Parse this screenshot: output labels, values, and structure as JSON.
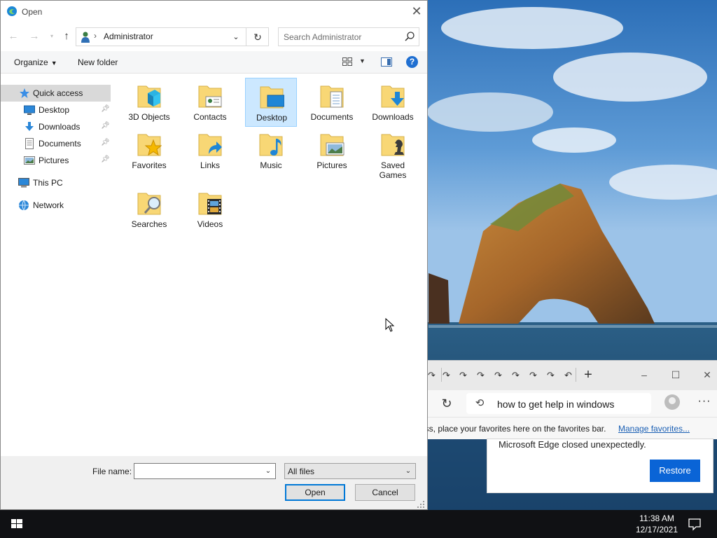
{
  "dialog": {
    "title": "Open",
    "nav": {
      "back_icon": "arrow-left-icon",
      "forward_icon": "arrow-right-icon",
      "recent_icon": "chevron-down-icon",
      "up_icon": "arrow-up-icon"
    },
    "path": {
      "crumb": "Administrator",
      "icon": "user-folder-icon"
    },
    "search": {
      "placeholder": "Search Administrator"
    },
    "command_bar": {
      "organize_label": "Organize",
      "new_folder_label": "New folder",
      "help_label": "?"
    },
    "nav_pane": {
      "items": [
        {
          "label": "Quick access",
          "icon": "star-icon",
          "selected": true
        },
        {
          "label": "Desktop",
          "icon": "desktop-icon",
          "pinned": true
        },
        {
          "label": "Downloads",
          "icon": "download-icon",
          "pinned": true
        },
        {
          "label": "Documents",
          "icon": "document-icon",
          "pinned": true
        },
        {
          "label": "Pictures",
          "icon": "pictures-icon",
          "pinned": true
        },
        {
          "label": "This PC",
          "icon": "computer-icon"
        },
        {
          "label": "Network",
          "icon": "network-icon"
        }
      ]
    },
    "folders": [
      {
        "label": "3D Objects",
        "icon": "cube-icon"
      },
      {
        "label": "Contacts",
        "icon": "contact-card-icon"
      },
      {
        "label": "Desktop",
        "icon": "desktop-icon",
        "selected": true
      },
      {
        "label": "Documents",
        "icon": "document-icon"
      },
      {
        "label": "Downloads",
        "icon": "download-icon"
      },
      {
        "label": "Favorites",
        "icon": "star-icon"
      },
      {
        "label": "Links",
        "icon": "link-arrow-icon"
      },
      {
        "label": "Music",
        "icon": "music-note-icon"
      },
      {
        "label": "Pictures",
        "icon": "pictures-icon"
      },
      {
        "label": "Saved Games",
        "icon": "chess-piece-icon"
      },
      {
        "label": "Searches",
        "icon": "magnifier-icon"
      },
      {
        "label": "Videos",
        "icon": "film-strip-icon"
      }
    ],
    "footer": {
      "file_name_label": "File name:",
      "file_name_value": "",
      "filter_value": "All files",
      "open_label": "Open",
      "cancel_label": "Cancel"
    }
  },
  "edge": {
    "address_text": "how to get help in windows",
    "favorites_text": "ess, place your favorites here on the favorites bar.",
    "manage_favorites_label": "Manage favorites...",
    "new_tab_label": "+",
    "crash_message": "Microsoft Edge closed unexpectedly.",
    "restore_label": "Restore"
  },
  "taskbar": {
    "time": "11:38 AM",
    "date": "12/17/2021"
  },
  "colors": {
    "accent": "#0078d7",
    "selection": "#cce8ff",
    "folder": "#f8d775",
    "restore_button": "#0a64d6"
  }
}
